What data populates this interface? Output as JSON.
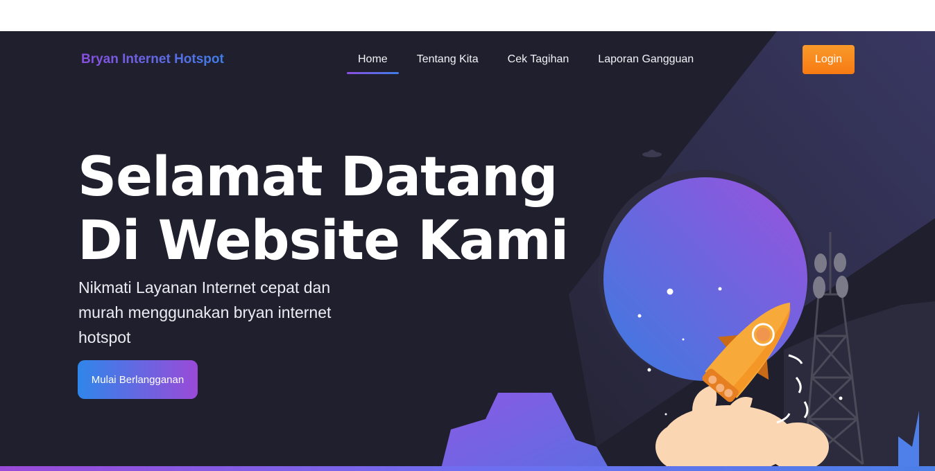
{
  "navbar": {
    "brand": "Bryan Internet Hotspot",
    "links": [
      {
        "label": "Home",
        "active": true
      },
      {
        "label": "Tentang Kita",
        "active": false
      },
      {
        "label": "Cek Tagihan",
        "active": false
      },
      {
        "label": "Laporan Gangguan",
        "active": false
      }
    ],
    "login_label": "Login"
  },
  "hero": {
    "title_line1": "Selamat Datang",
    "title_line2": "Di Website Kami",
    "subtitle": "Nikmati Layanan Internet cepat dan murah menggunakan bryan internet hotspot",
    "cta_label": "Mulai Berlangganan"
  },
  "colors": {
    "background": "#201f2d",
    "brand_gradient_start": "#8a4fe0",
    "brand_gradient_end": "#3f7ee8",
    "login_button": "#f7861d",
    "rocket": "#f7a93a"
  },
  "icons": {
    "illustration": "rocket-launch-illustration",
    "tower": "radio-tower-icon",
    "planet": "planet-icon",
    "ufo": "ufo-icon"
  }
}
